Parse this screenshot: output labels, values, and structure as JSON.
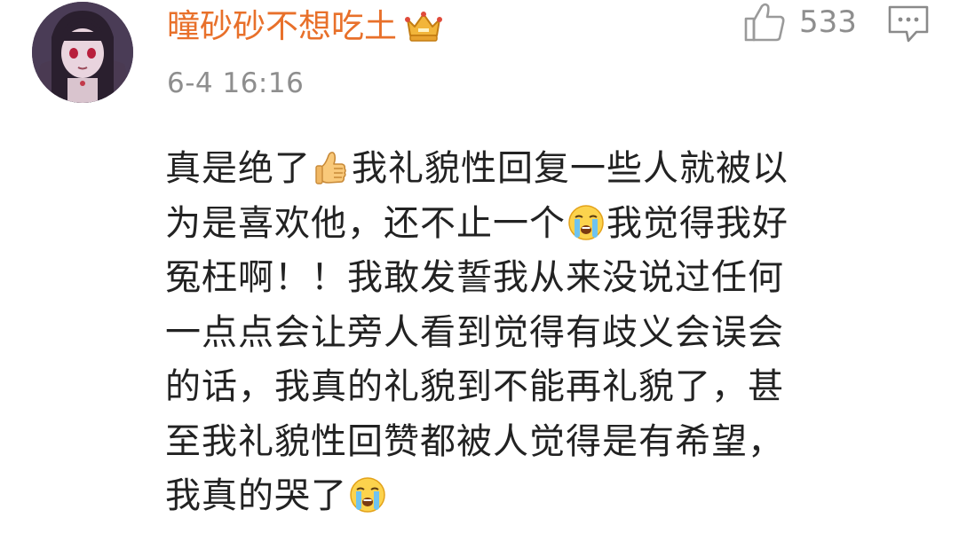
{
  "comment": {
    "user": {
      "name": "曈砂砂不想吃土",
      "avatar_icon": "anime-avatar",
      "badge_icon": "vip-crown-icon",
      "name_color": "#e8702a"
    },
    "timestamp": "6-4 16:16",
    "likes": {
      "icon": "thumbs-up-icon",
      "count": "533"
    },
    "reply_icon": "comment-reply-icon",
    "lines": [
      [
        "真是绝了",
        "👍",
        "我礼貌性回复一些人就被以"
      ],
      [
        "为是喜欢他，还不止一个",
        "😭",
        "我觉得我好"
      ],
      [
        "冤枉啊！！我敢发誓我从来没说过任何"
      ],
      [
        "一点点会让旁人看到觉得有歧义会误会"
      ],
      [
        "的话，我真的礼貌到不能再礼貌了，甚"
      ],
      [
        "至我礼貌性回赞都被人觉得是有希望，"
      ],
      [
        "我真的哭了",
        "😭"
      ]
    ],
    "text": {
      "l1a": "真是绝了",
      "l1b": "我礼貌性回复一些人就被以",
      "l2a": "为是喜欢他，还不止一个",
      "l2b": "我觉得我好",
      "l3": "冤枉啊！！我敢发誓我从来没说过任何",
      "l4": "一点点会让旁人看到觉得有歧义会误会",
      "l5": "的话，我真的礼貌到不能再礼貌了，甚",
      "l6": "至我礼貌性回赞都被人觉得是有希望，",
      "l7": "我真的哭了"
    },
    "emoji_names": [
      "thumbs-up-emoji",
      "crying-face-emoji",
      "crying-face-emoji"
    ]
  }
}
